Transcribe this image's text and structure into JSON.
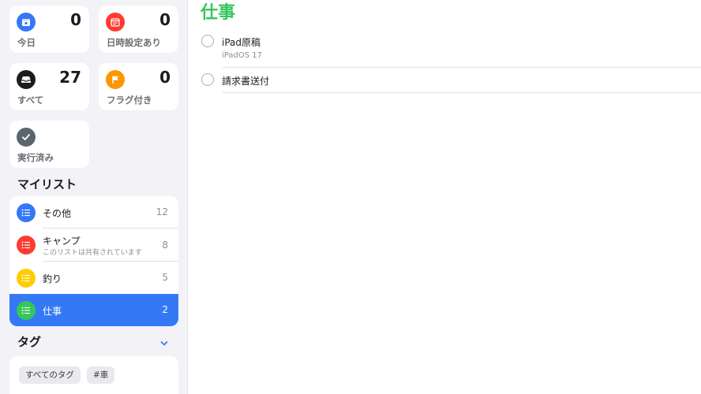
{
  "smart_lists": [
    {
      "label": "今日",
      "count": "0",
      "color": "#3478f6",
      "icon": "calendar-today-icon"
    },
    {
      "label": "日時設定あり",
      "count": "0",
      "color": "#ff3b30",
      "icon": "calendar-grid-icon"
    },
    {
      "label": "すべて",
      "count": "27",
      "color": "#1c1c1e",
      "icon": "tray-icon"
    },
    {
      "label": "フラグ付き",
      "count": "0",
      "color": "#ff9500",
      "icon": "flag-icon"
    },
    {
      "label": "実行済み",
      "count": "",
      "color": "#5a6570",
      "icon": "checkmark-icon"
    }
  ],
  "my_lists": {
    "title": "マイリスト",
    "items": [
      {
        "name": "その他",
        "subtitle": "",
        "count": "12",
        "color": "#3478f6"
      },
      {
        "name": "キャンプ",
        "subtitle": "このリストは共有されています",
        "count": "8",
        "color": "#ff3b30"
      },
      {
        "name": "釣り",
        "subtitle": "",
        "count": "5",
        "color": "#ffcc00"
      },
      {
        "name": "仕事",
        "subtitle": "",
        "count": "2",
        "color": "#34c759",
        "selected": true
      }
    ]
  },
  "tags": {
    "title": "タグ",
    "items": [
      "すべてのタグ",
      "#車"
    ]
  },
  "main": {
    "title": "仕事",
    "title_color": "#34c759",
    "tasks": [
      {
        "name": "iPad原稿",
        "note": "iPadOS 17"
      },
      {
        "name": "請求書送付",
        "note": ""
      }
    ]
  }
}
